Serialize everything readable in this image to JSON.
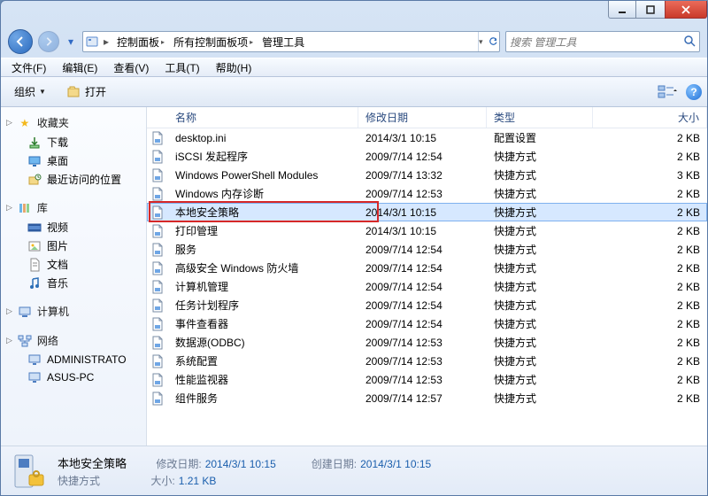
{
  "title_buttons": {
    "minimize": "–",
    "maximize": "☐",
    "close": "X"
  },
  "breadcrumb": [
    "控制面板",
    "所有控制面板项",
    "管理工具"
  ],
  "search_placeholder": "搜索 管理工具",
  "menus": [
    "文件(F)",
    "编辑(E)",
    "查看(V)",
    "工具(T)",
    "帮助(H)"
  ],
  "toolbar": {
    "organize": "组织",
    "open": "打开"
  },
  "sidebar": {
    "favorites": {
      "label": "收藏夹",
      "items": [
        {
          "label": "下载",
          "icon": "download"
        },
        {
          "label": "桌面",
          "icon": "desktop"
        },
        {
          "label": "最近访问的位置",
          "icon": "recent"
        }
      ]
    },
    "libraries": {
      "label": "库",
      "items": [
        {
          "label": "视频",
          "icon": "video"
        },
        {
          "label": "图片",
          "icon": "picture"
        },
        {
          "label": "文档",
          "icon": "doc"
        },
        {
          "label": "音乐",
          "icon": "music"
        }
      ]
    },
    "computer": {
      "label": "计算机",
      "items": []
    },
    "network": {
      "label": "网络",
      "items": [
        {
          "label": "ADMINISTRATO",
          "icon": "pc"
        },
        {
          "label": "ASUS-PC",
          "icon": "pc"
        }
      ]
    }
  },
  "columns": {
    "name": "名称",
    "date": "修改日期",
    "type": "类型",
    "size": "大小"
  },
  "files": [
    {
      "name": "desktop.ini",
      "date": "2014/3/1 10:15",
      "type": "配置设置",
      "size": "2 KB"
    },
    {
      "name": "iSCSI 发起程序",
      "date": "2009/7/14 12:54",
      "type": "快捷方式",
      "size": "2 KB"
    },
    {
      "name": "Windows PowerShell Modules",
      "date": "2009/7/14 13:32",
      "type": "快捷方式",
      "size": "3 KB"
    },
    {
      "name": "Windows 内存诊断",
      "date": "2009/7/14 12:53",
      "type": "快捷方式",
      "size": "2 KB"
    },
    {
      "name": "本地安全策略",
      "date": "2014/3/1 10:15",
      "type": "快捷方式",
      "size": "2 KB",
      "selected": true,
      "highlight": true
    },
    {
      "name": "打印管理",
      "date": "2014/3/1 10:15",
      "type": "快捷方式",
      "size": "2 KB"
    },
    {
      "name": "服务",
      "date": "2009/7/14 12:54",
      "type": "快捷方式",
      "size": "2 KB"
    },
    {
      "name": "高级安全 Windows 防火墙",
      "date": "2009/7/14 12:54",
      "type": "快捷方式",
      "size": "2 KB"
    },
    {
      "name": "计算机管理",
      "date": "2009/7/14 12:54",
      "type": "快捷方式",
      "size": "2 KB"
    },
    {
      "name": "任务计划程序",
      "date": "2009/7/14 12:54",
      "type": "快捷方式",
      "size": "2 KB"
    },
    {
      "name": "事件查看器",
      "date": "2009/7/14 12:54",
      "type": "快捷方式",
      "size": "2 KB"
    },
    {
      "name": "数据源(ODBC)",
      "date": "2009/7/14 12:53",
      "type": "快捷方式",
      "size": "2 KB"
    },
    {
      "name": "系统配置",
      "date": "2009/7/14 12:53",
      "type": "快捷方式",
      "size": "2 KB"
    },
    {
      "name": "性能监视器",
      "date": "2009/7/14 12:53",
      "type": "快捷方式",
      "size": "2 KB"
    },
    {
      "name": "组件服务",
      "date": "2009/7/14 12:57",
      "type": "快捷方式",
      "size": "2 KB"
    }
  ],
  "details": {
    "title": "本地安全策略",
    "subtitle": "快捷方式",
    "modified_label": "修改日期:",
    "modified_value": "2014/3/1 10:15",
    "created_label": "创建日期:",
    "created_value": "2014/3/1 10:15",
    "size_label": "大小:",
    "size_value": "1.21 KB"
  }
}
